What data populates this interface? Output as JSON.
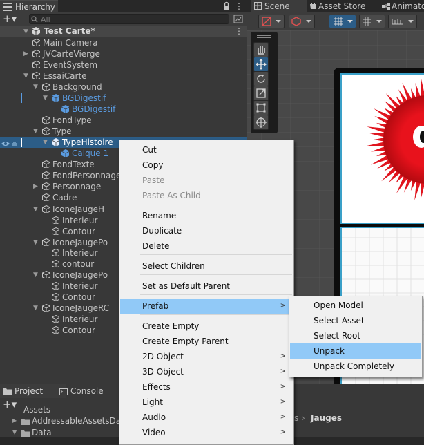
{
  "hierarchy": {
    "tab_title": "Hierarchy",
    "search_placeholder": "All",
    "add_button": "+▾",
    "scene_name": "Test Carte*",
    "items": [
      {
        "label": "Main Camera"
      },
      {
        "label": "JVCarteVierge"
      },
      {
        "label": "EventSystem"
      },
      {
        "label": "EssaiCarte"
      },
      {
        "label": "Background"
      },
      {
        "label": "BGDigestif"
      },
      {
        "label": "BGDigestif"
      },
      {
        "label": "FondType"
      },
      {
        "label": "Type"
      },
      {
        "label": "TypeHistoire"
      },
      {
        "label": "Calque 1"
      },
      {
        "label": "FondTexte"
      },
      {
        "label": "FondPersonnage"
      },
      {
        "label": "Personnage"
      },
      {
        "label": "Cadre"
      },
      {
        "label": "IconeJaugeH"
      },
      {
        "label": "Interieur"
      },
      {
        "label": "Contour"
      },
      {
        "label": "IconeJaugePo"
      },
      {
        "label": "Interieur"
      },
      {
        "label": "contour"
      },
      {
        "label": "IconeJaugePo"
      },
      {
        "label": "Interieur"
      },
      {
        "label": "Contour"
      },
      {
        "label": "IconeJaugeRC"
      },
      {
        "label": "Interieur"
      },
      {
        "label": "Contour"
      }
    ]
  },
  "scene_tabs": {
    "scene": "Scene",
    "asset_store": "Asset Store",
    "animator": "Animato"
  },
  "bottom": {
    "project_tab": "Project",
    "console_tab": "Console",
    "assets_label": "Assets",
    "tree_item_1": "AddressableAssetsDat",
    "tree_item_2": "Data",
    "breadcrumb_tail": "s",
    "breadcrumb_sep": "›",
    "breadcrumb_current": "Jauges"
  },
  "context_menu": {
    "items": [
      {
        "label": "Cut",
        "disabled": false
      },
      {
        "label": "Copy",
        "disabled": false
      },
      {
        "label": "Paste",
        "disabled": true
      },
      {
        "label": "Paste As Child",
        "disabled": true
      },
      {
        "label": "Rename",
        "disabled": false
      },
      {
        "label": "Duplicate",
        "disabled": false
      },
      {
        "label": "Delete",
        "disabled": false
      },
      {
        "label": "Select Children",
        "disabled": false
      },
      {
        "label": "Set as Default Parent",
        "disabled": false
      },
      {
        "label": "Prefab",
        "disabled": false,
        "submenu": true
      },
      {
        "label": "Create Empty",
        "disabled": false
      },
      {
        "label": "Create Empty Parent",
        "disabled": false
      },
      {
        "label": "2D Object",
        "submenu": true
      },
      {
        "label": "3D Object",
        "submenu": true
      },
      {
        "label": "Effects",
        "submenu": true
      },
      {
        "label": "Light",
        "submenu": true
      },
      {
        "label": "Audio",
        "submenu": true
      },
      {
        "label": "Video",
        "submenu": true
      }
    ]
  },
  "prefab_submenu": {
    "items": [
      {
        "label": "Open Model"
      },
      {
        "label": "Select Asset"
      },
      {
        "label": "Select Root"
      },
      {
        "label": "Unpack"
      },
      {
        "label": "Unpack Completely"
      }
    ]
  },
  "colors": {
    "selection": "#2c5d87",
    "menu_highlight": "#91c9f7",
    "prefab_blue": "#5a9be0",
    "creature_red": "#e0141e"
  }
}
